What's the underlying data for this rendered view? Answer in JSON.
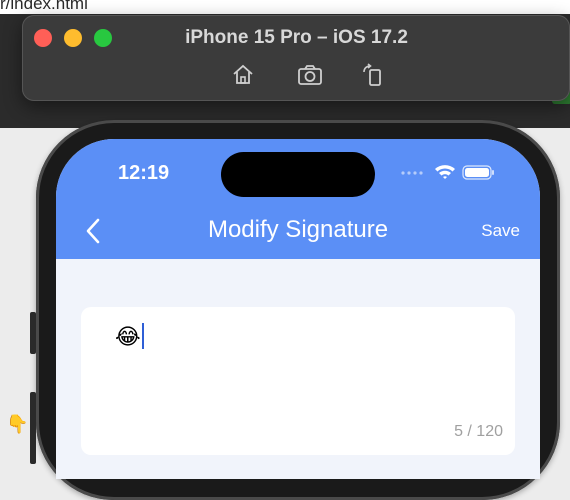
{
  "host_page": {
    "url_fragment": "r/index.html",
    "cursor_glyph": "👇"
  },
  "simulator": {
    "title": "iPhone 15 Pro – iOS 17.2",
    "toolbar": [
      {
        "name": "home-icon",
        "label": "Home"
      },
      {
        "name": "screenshot-icon",
        "label": "Screenshot"
      },
      {
        "name": "rotate-icon",
        "label": "Rotate"
      }
    ]
  },
  "status_bar": {
    "time": "12:19"
  },
  "nav": {
    "back_icon": "chevron-left-icon",
    "title": "Modify Signature",
    "save_label": "Save"
  },
  "signature": {
    "value": "😂",
    "counter": "5 / 120"
  },
  "colors": {
    "nav_blue": "#5b8ff6",
    "caret": "#2f5fd6",
    "page_bg": "#f1f4fb"
  }
}
